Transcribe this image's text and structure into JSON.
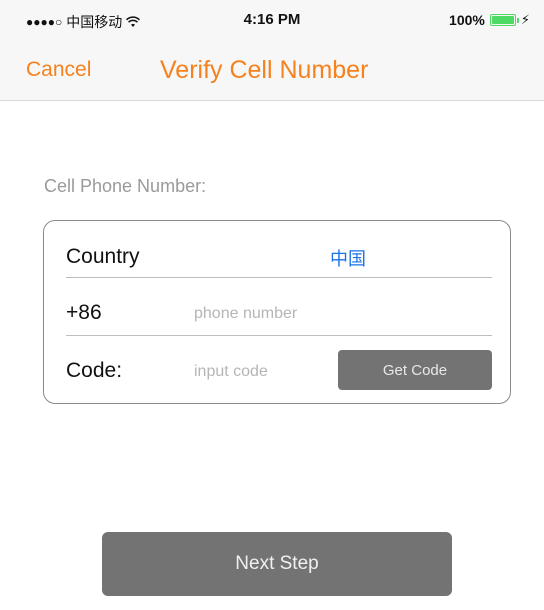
{
  "status_bar": {
    "signal": "●●●●○",
    "carrier": "中国移动",
    "time": "4:16 PM",
    "battery": "100%",
    "charge_glyph": "⚡"
  },
  "nav": {
    "cancel_label": "Cancel",
    "title": "Verify Cell Number",
    "accent_color": "#f5821f"
  },
  "form": {
    "section_label": "Cell Phone Number:",
    "country_label": "Country",
    "country_value": "中国",
    "dial_code": "+86",
    "phone_placeholder": "phone number",
    "phone_value": "",
    "code_label": "Code:",
    "code_placeholder": "input code",
    "code_value": "",
    "get_code_label": "Get Code"
  },
  "footer": {
    "next_label": "Next Step"
  }
}
